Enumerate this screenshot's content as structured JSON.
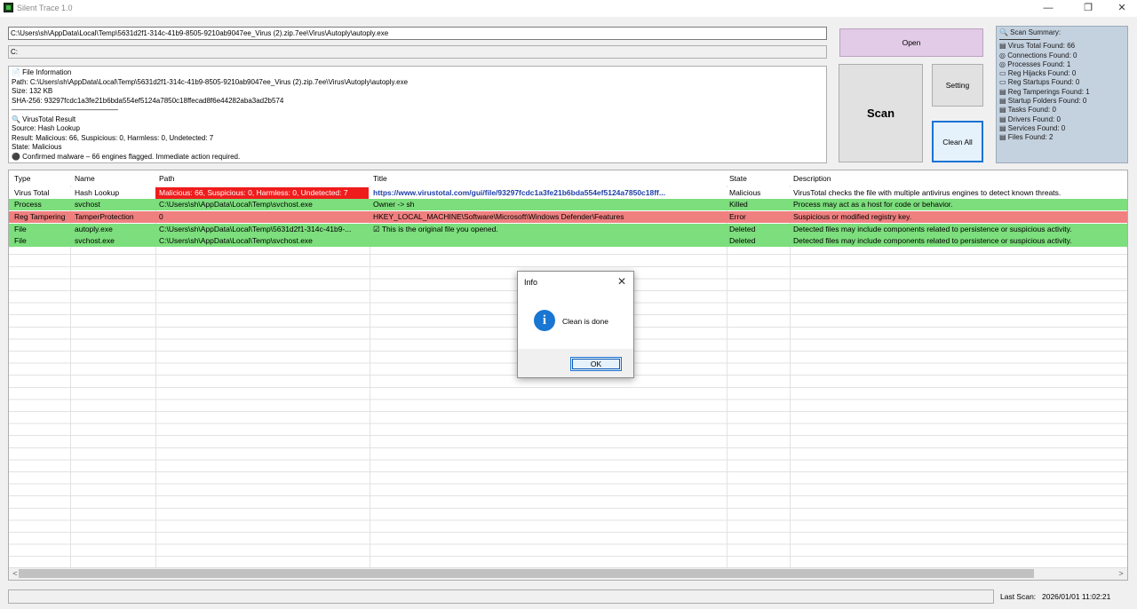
{
  "window": {
    "title": "Silent Trace 1.0",
    "min_icon": "—",
    "restore_icon": "❐",
    "close_icon": "✕"
  },
  "inputs": {
    "path_value": "C:\\Users\\sh\\AppData\\Local\\Temp\\5631d2f1-314c-41b9-8505-9210ab9047ee_Virus (2).zip.7ee\\Virus\\Autoply\\autoply.exe",
    "drive_value": "C:"
  },
  "info_lines": [
    "📄 File Information",
    "Path: C:\\Users\\sh\\AppData\\Local\\Temp\\5631d2f1-314c-41b9-8505-9210ab9047ee_Virus (2).zip.7ee\\Virus\\Autoply\\autoply.exe",
    "Size: 132 KB",
    "SHA-256: 93297fcdc1a3fe21b6bda554ef5124a7850c18ffecad8f6e44282aba3ad2b574",
    "———————————————",
    "🔍 VirusTotal Result",
    "Source: Hash Lookup",
    "Result: Malicious: 66, Suspicious: 0, Harmless: 0, Undetected: 7",
    "State: Malicious",
    "⚫ Confirmed malware – 66 engines flagged. Immediate action required."
  ],
  "buttons": {
    "open": "Open",
    "scan": "Scan",
    "setting": "Setting",
    "clean_all": "Clean All"
  },
  "summary": {
    "title": "🔍 Scan Summary:",
    "items": [
      "▤ Virus Total Found: 66",
      "◎ Connections Found: 0",
      "◎ Processes Found: 1",
      "▭ Reg Hijacks Found: 0",
      "▭ Reg Startups Found: 0",
      "▤ Reg Tamperings Found: 1",
      "▤ Startup Folders Found: 0",
      "▤ Tasks Found: 0",
      "▤ Drivers Found: 0",
      "▤ Services Found: 0",
      "▤ Files Found: 2"
    ]
  },
  "table": {
    "columns": [
      "Type",
      "Name",
      "Path",
      "Title",
      "State",
      "Description"
    ],
    "rows": [
      {
        "type": "Virus Total",
        "name": "Hash Lookup",
        "path": "Malicious: 66, Suspicious: 0, Harmless: 0, Undetected: 7",
        "title": "https://www.virustotal.com/gui/file/93297fcdc1a3fe21b6bda554ef5124a7850c18ff...",
        "state": "Malicious",
        "description": "VirusTotal checks the file with multiple antivirus engines to detect known threats.",
        "color": "white"
      },
      {
        "type": "Process",
        "name": "svchost",
        "path": "C:\\Users\\sh\\AppData\\Local\\Temp\\svchost.exe",
        "title": "Owner -> sh",
        "state": "Killed",
        "description": "Process may act as a host for code or behavior.",
        "color": "#7cde7c"
      },
      {
        "type": "Reg Tampering",
        "name": "TamperProtection",
        "path": "0",
        "title": "HKEY_LOCAL_MACHINE\\Software\\Microsoft\\Windows Defender\\Features",
        "state": "Error",
        "description": "Suspicious or modified registry key.",
        "color": "#f08080"
      },
      {
        "type": "File",
        "name": "autoply.exe",
        "path": "C:\\Users\\sh\\AppData\\Local\\Temp\\5631d2f1-314c-41b9-...",
        "title": "☑ This is the original file you opened.",
        "state": "Deleted",
        "description": "Detected files may include components related to persistence or suspicious activity.",
        "color": "#7cde7c"
      },
      {
        "type": "File",
        "name": "svchost.exe",
        "path": "C:\\Users\\sh\\AppData\\Local\\Temp\\svchost.exe",
        "title": "",
        "state": "Deleted",
        "description": "Detected files may include components related to persistence or suspicious activity.",
        "color": "#7cde7c"
      }
    ]
  },
  "scrollbar": {
    "left_arrow": "<",
    "right_arrow": ">"
  },
  "status": {
    "last_scan_label": "Last Scan:",
    "last_scan_value": "2026/01/01 11:02:21"
  },
  "dialog": {
    "title": "Info",
    "message": "Clean is done",
    "ok": "OK",
    "icon": "i",
    "close": "✕"
  },
  "colors": {
    "open_button": "#e1cbe6",
    "summary_bg": "#c4d1df",
    "row_green": "#7cde7c",
    "row_red": "#f08080",
    "cell_red": "#ef1c1c",
    "accent": "#1a73d2"
  }
}
